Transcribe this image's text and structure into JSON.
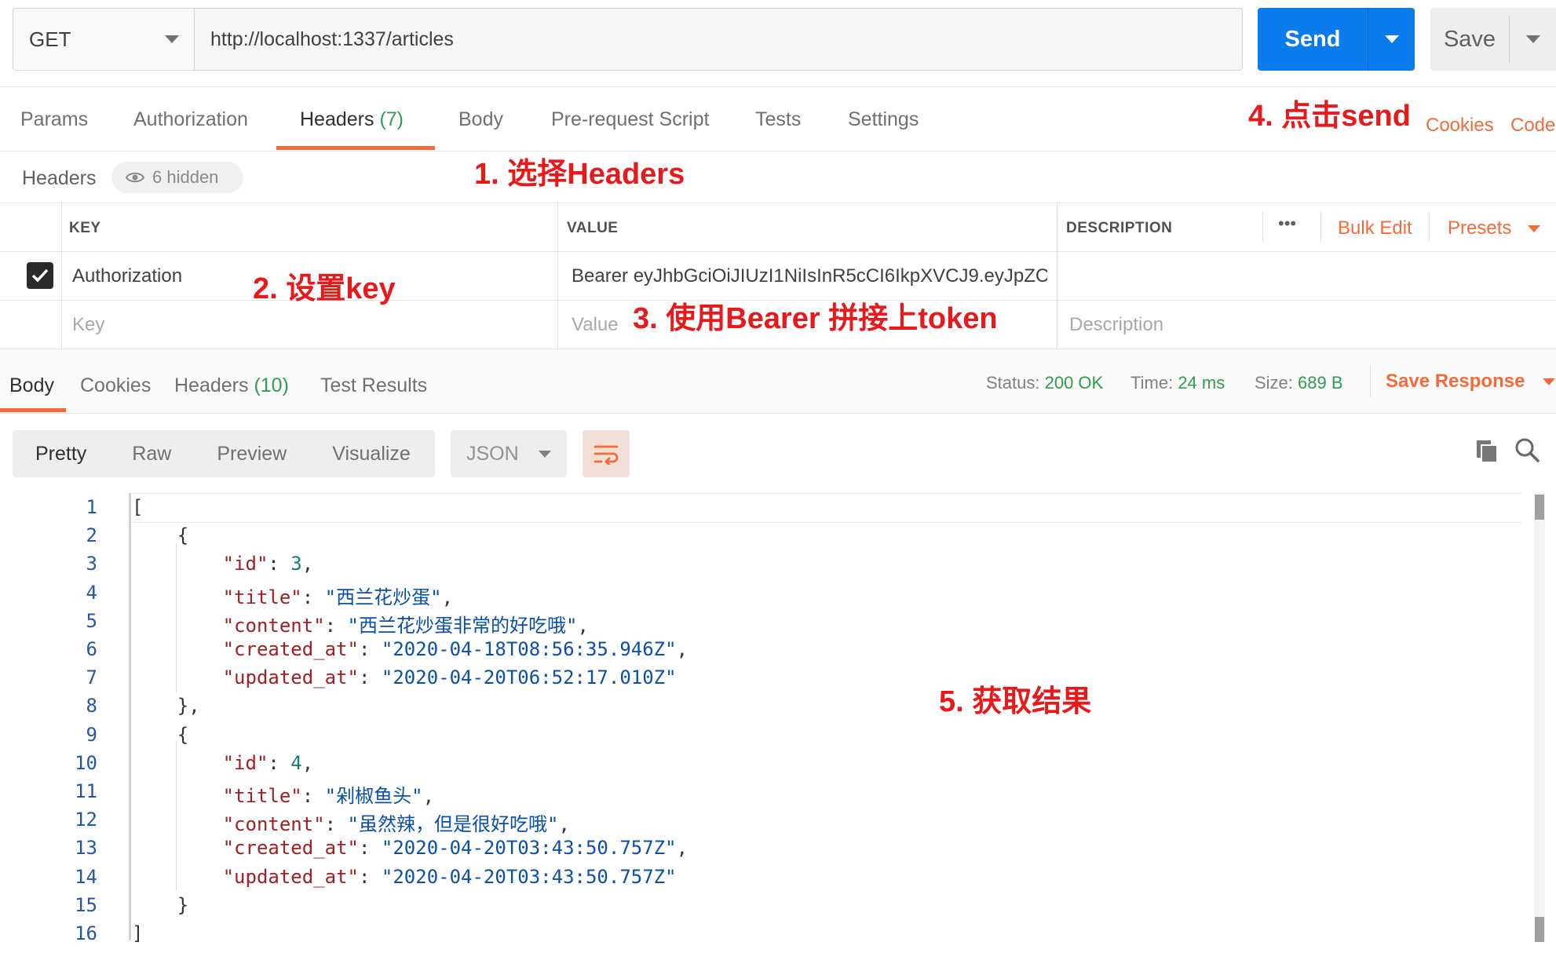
{
  "request": {
    "method": "GET",
    "url": "http://localhost:1337/articles",
    "send_label": "Send",
    "save_label": "Save"
  },
  "request_tabs": [
    {
      "label": "Params"
    },
    {
      "label": "Authorization"
    },
    {
      "label": "Headers",
      "count": "(7)"
    },
    {
      "label": "Body"
    },
    {
      "label": "Pre-request Script"
    },
    {
      "label": "Tests"
    },
    {
      "label": "Settings"
    }
  ],
  "right_links": {
    "cookies": "Cookies",
    "code": "Code"
  },
  "headers_section": {
    "title": "Headers",
    "hidden": "6 hidden",
    "columns": {
      "key": "KEY",
      "value": "VALUE",
      "description": "DESCRIPTION"
    },
    "more": "•••",
    "bulk_edit": "Bulk Edit",
    "presets": "Presets",
    "rows": [
      {
        "key": "Authorization",
        "value": "Bearer eyJhbGciOiJIUzI1NiIsInR5cCI6IkpXVCJ9.eyJpZC",
        "ellipsis": "...",
        "description": ""
      }
    ],
    "placeholders": {
      "key": "Key",
      "value": "Value",
      "description": "Description"
    }
  },
  "annotations": {
    "a1": "1. 选择Headers",
    "a2": "2. 设置key",
    "a3": "3. 使用Bearer 拼接上token",
    "a4": "4. 点击send",
    "a5": "5. 获取结果"
  },
  "response": {
    "tabs": [
      {
        "label": "Body"
      },
      {
        "label": "Cookies"
      },
      {
        "label": "Headers",
        "count": "(10)"
      },
      {
        "label": "Test Results"
      }
    ],
    "status_label": "Status:",
    "status": "200 OK",
    "time_label": "Time:",
    "time": "24 ms",
    "size_label": "Size:",
    "size": "689 B",
    "save_response": "Save Response",
    "view_modes": [
      "Pretty",
      "Raw",
      "Preview",
      "Visualize"
    ],
    "format": "JSON"
  },
  "code_lines": [
    {
      "n": "1"
    },
    {
      "n": "2"
    },
    {
      "n": "3"
    },
    {
      "n": "4"
    },
    {
      "n": "5"
    },
    {
      "n": "6"
    },
    {
      "n": "7"
    },
    {
      "n": "8"
    },
    {
      "n": "9"
    },
    {
      "n": "10"
    },
    {
      "n": "11"
    },
    {
      "n": "12"
    },
    {
      "n": "13"
    },
    {
      "n": "14"
    },
    {
      "n": "15"
    },
    {
      "n": "16"
    }
  ],
  "articles": [
    {
      "id": "3",
      "title": "\"西兰花炒蛋\"",
      "content": "\"西兰花炒蛋非常的好吃哦\"",
      "created_at": "\"2020-04-18T08:56:35.946Z\"",
      "updated_at": "\"2020-04-20T06:52:17.010Z\""
    },
    {
      "id": "4",
      "title": "\"剁椒鱼头\"",
      "content": "\"虽然辣，但是很好吃哦\"",
      "created_at": "\"2020-04-20T03:43:50.757Z\"",
      "updated_at": "\"2020-04-20T03:43:50.757Z\""
    }
  ],
  "keys": {
    "id": "\"id\"",
    "title": "\"title\"",
    "content": "\"content\"",
    "created_at": "\"created_at\"",
    "updated_at": "\"updated_at\""
  }
}
